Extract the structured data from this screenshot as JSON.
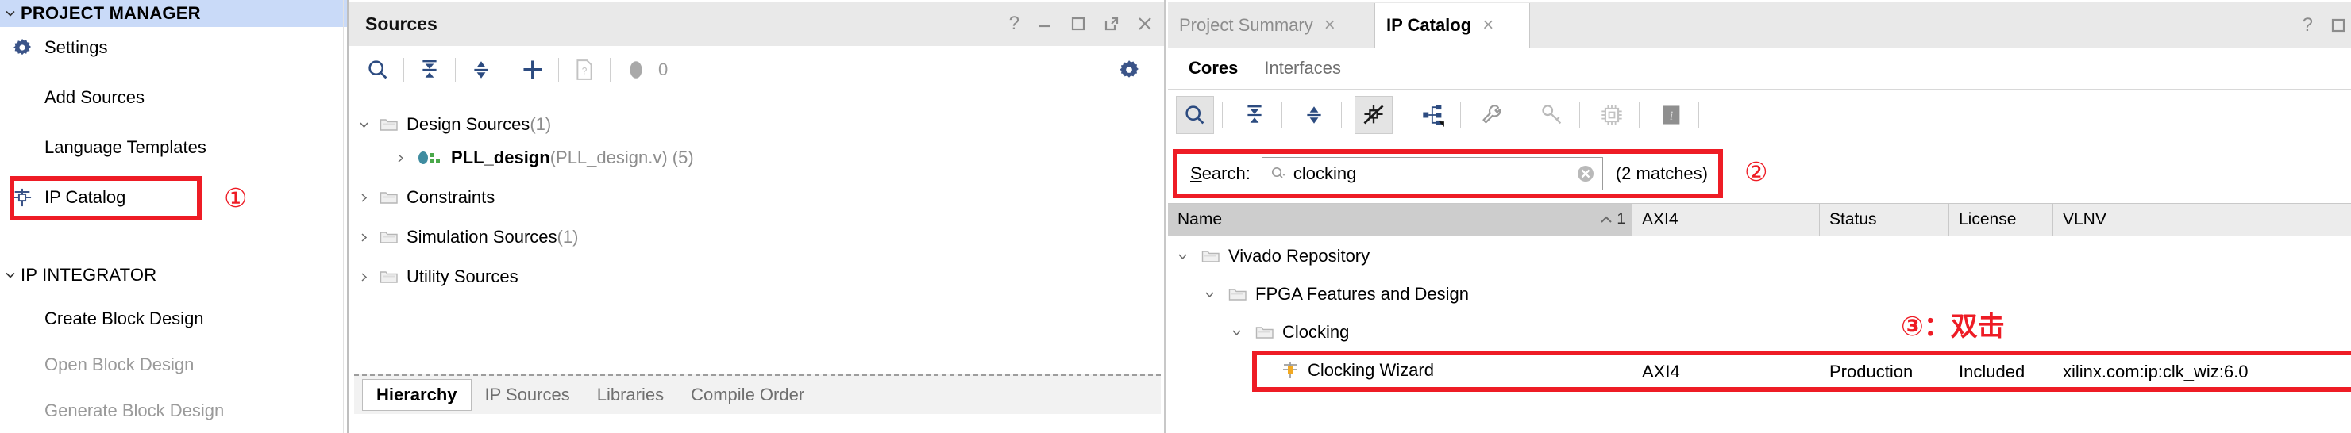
{
  "sidebar": {
    "sections": [
      {
        "title": "PROJECT MANAGER",
        "caret": "chevron-down-icon",
        "items": [
          {
            "label": "Settings",
            "icon": "gear-icon",
            "disabled": false
          },
          {
            "label": "Add Sources",
            "icon": "",
            "disabled": false
          },
          {
            "label": "Language Templates",
            "icon": "",
            "disabled": false
          },
          {
            "label": "IP Catalog",
            "icon": "ip-catalog-icon",
            "disabled": false
          }
        ]
      },
      {
        "title": "IP INTEGRATOR",
        "caret": "chevron-down-icon",
        "items": [
          {
            "label": "Create Block Design",
            "icon": "",
            "disabled": false
          },
          {
            "label": "Open Block Design",
            "icon": "",
            "disabled": true
          },
          {
            "label": "Generate Block Design",
            "icon": "",
            "disabled": true
          }
        ]
      }
    ]
  },
  "annotations": {
    "one": "①",
    "two": "②",
    "three": "③：双击",
    "color": "#ee1c25"
  },
  "sources_panel": {
    "title": "Sources",
    "window_buttons": [
      "help-icon",
      "minimize-icon",
      "maximize-icon",
      "float-icon",
      "close-icon"
    ],
    "toolbar": {
      "buttons": [
        "search-icon",
        "collapse-all-icon",
        "expand-all-icon",
        "add-sources-icon",
        "report-icon"
      ],
      "badge_count": "0",
      "settings": "gear-icon"
    },
    "tree": [
      {
        "indent": 0,
        "arrow": "v",
        "icon": "folder-icon",
        "text": "Design Sources",
        "suffix": " (1)",
        "bold": false
      },
      {
        "indent": 1,
        "arrow": ">",
        "icon": "verilog-module-icon",
        "text": "PLL_design",
        "suffix": " (PLL_design.v) (5)",
        "bold": true
      },
      {
        "indent": 0,
        "arrow": ">",
        "icon": "folder-icon",
        "text": "Constraints",
        "suffix": "",
        "bold": false
      },
      {
        "indent": 0,
        "arrow": ">",
        "icon": "folder-icon",
        "text": "Simulation Sources",
        "suffix": " (1)",
        "bold": false
      },
      {
        "indent": 0,
        "arrow": ">",
        "icon": "folder-icon",
        "text": "Utility Sources",
        "suffix": "",
        "bold": false
      }
    ],
    "tabs": [
      {
        "label": "Hierarchy",
        "active": true
      },
      {
        "label": "IP Sources",
        "active": false
      },
      {
        "label": "Libraries",
        "active": false
      },
      {
        "label": "Compile Order",
        "active": false
      }
    ]
  },
  "ip_catalog": {
    "tabs": [
      {
        "label": "Project Summary",
        "active": false,
        "close": "×"
      },
      {
        "label": "IP Catalog",
        "active": true,
        "close": "×"
      }
    ],
    "window_buttons": [
      "help-icon",
      "maximize-icon"
    ],
    "subtabs": [
      {
        "label": "Cores",
        "active": true
      },
      {
        "label": "Interfaces",
        "active": false
      }
    ],
    "toolbar_buttons": [
      "search-icon",
      "collapse-all-icon",
      "expand-all-icon",
      "hide-disabled-icon",
      "group-by-icon",
      "settings-wrench-icon",
      "license-key-icon",
      "chip-icon",
      "info-icon"
    ],
    "search": {
      "label_prefix": "S",
      "label_rest": "earch:",
      "value": "clocking",
      "placeholder": "",
      "clear": "clear-icon",
      "matches": "(2 matches)"
    },
    "columns": [
      {
        "label": "Name",
        "sorted": true,
        "sort_dir": "^",
        "sort_num": "1"
      },
      {
        "label": "AXI4",
        "sorted": false
      },
      {
        "label": "Status",
        "sorted": false
      },
      {
        "label": "License",
        "sorted": false
      },
      {
        "label": "VLNV",
        "sorted": false
      }
    ],
    "rows": [
      {
        "indent": 0,
        "arrow": "v",
        "icon": "folder-icon",
        "name": "Vivado Repository",
        "axi4": "",
        "status": "",
        "license": "",
        "vlnv": "",
        "highlight": false
      },
      {
        "indent": 1,
        "arrow": "v",
        "icon": "folder-icon",
        "name": "FPGA Features and Design",
        "axi4": "",
        "status": "",
        "license": "",
        "vlnv": "",
        "highlight": false
      },
      {
        "indent": 2,
        "arrow": "v",
        "icon": "folder-icon",
        "name": "Clocking",
        "axi4": "",
        "status": "",
        "license": "",
        "vlnv": "",
        "highlight": false
      },
      {
        "indent": 3,
        "arrow": "",
        "icon": "ip-core-icon",
        "name": "Clocking Wizard",
        "axi4": "AXI4",
        "status": "Production",
        "license": "Included",
        "vlnv": "xilinx.com:ip:clk_wiz:6.0",
        "highlight": true
      }
    ]
  }
}
